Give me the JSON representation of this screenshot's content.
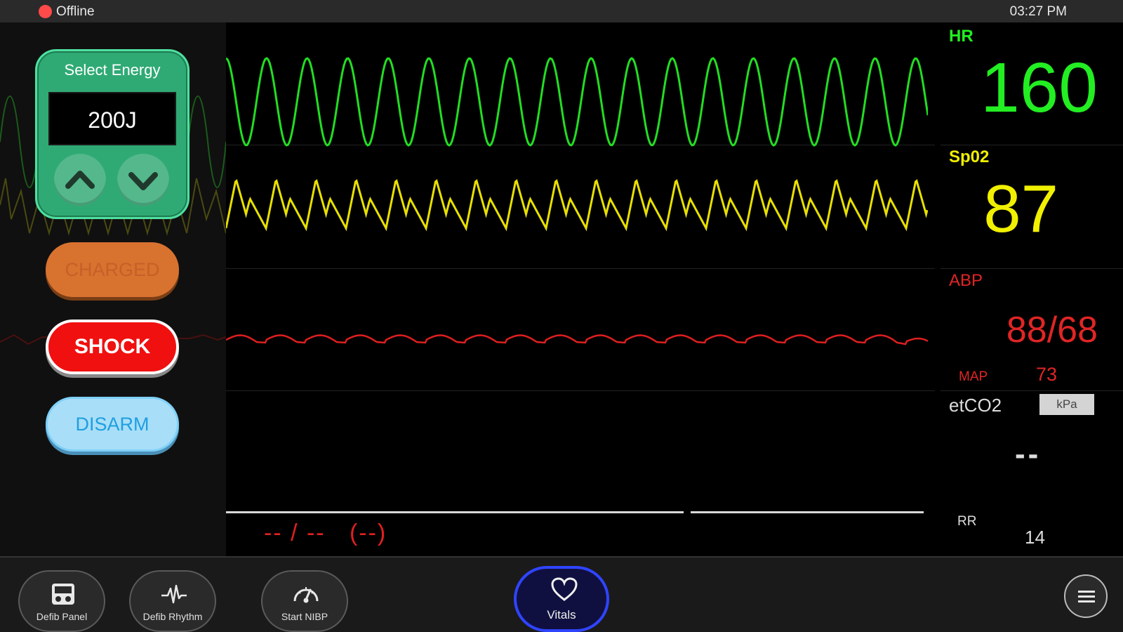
{
  "status": {
    "connection": "Offline",
    "time": "03:27 PM",
    "dot_color": "#ff4a4a"
  },
  "energy": {
    "title": "Select Energy",
    "value": "200J"
  },
  "controls": {
    "charged_label": "CHARGED",
    "shock_label": "SHOCK",
    "disarm_label": "DISARM"
  },
  "vitals": {
    "hr": {
      "label": "HR",
      "value": "160",
      "color": "#22ee22"
    },
    "spo2": {
      "label": "Sp02",
      "value": "87",
      "color": "#f0f000"
    },
    "abp": {
      "label": "ABP",
      "value": "88/68",
      "map_label": "MAP",
      "map_value": "73",
      "color": "#e02525"
    },
    "etco2": {
      "label": "etCO2",
      "unit_button": "kPa",
      "value": "--"
    },
    "rr": {
      "label": "RR",
      "value": "14"
    },
    "nibp": {
      "value": "-- / --   (--)"
    }
  },
  "toolbar": {
    "defib_panel": "Defib Panel",
    "defib_rhythm": "Defib Rhythm",
    "start_nibp": "Start NIBP",
    "vitals": "Vitals"
  }
}
